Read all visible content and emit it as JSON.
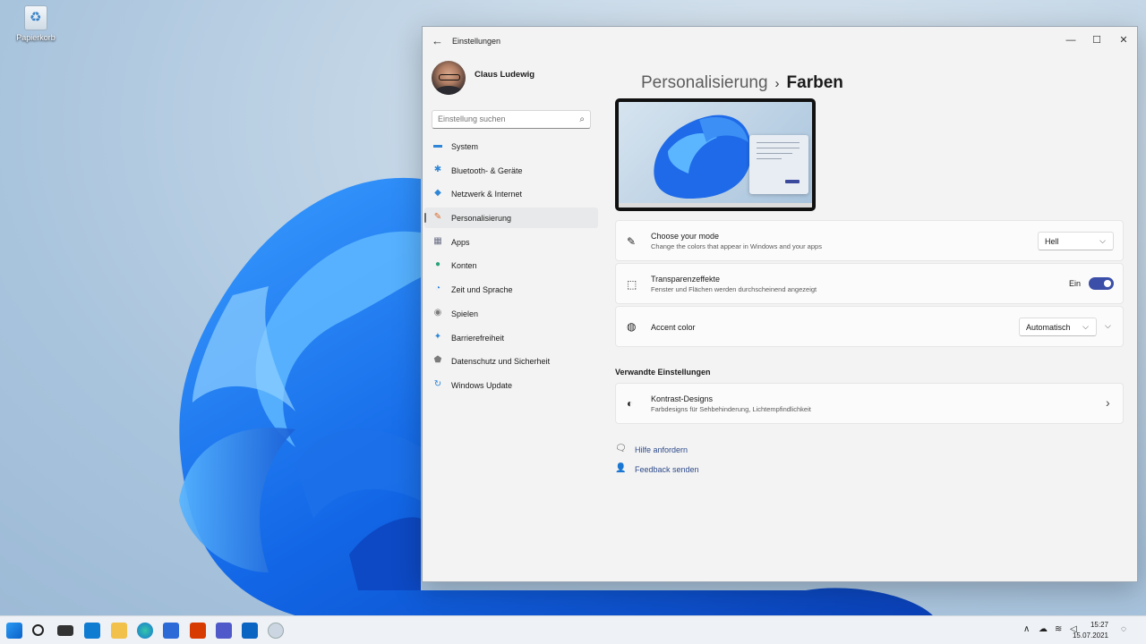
{
  "desktop": {
    "recycle_bin_label": "Papierkorb"
  },
  "window": {
    "title": "Einstellungen",
    "back_icon": "←",
    "minimize": "—",
    "maximize": "☐",
    "close": "✕"
  },
  "profile": {
    "name": "Claus Ludewig"
  },
  "search": {
    "placeholder": "Einstellung suchen",
    "icon": "⌕"
  },
  "nav": [
    {
      "label": "System",
      "icon": "▬",
      "color": "#2f86d8"
    },
    {
      "label": "Bluetooth- & Geräte",
      "icon": "✱",
      "color": "#2f86d8"
    },
    {
      "label": "Netzwerk & Internet",
      "icon": "◆",
      "color": "#2f86d8"
    },
    {
      "label": "Personalisierung",
      "icon": "✎",
      "color": "#d96a2b",
      "active": true
    },
    {
      "label": "Apps",
      "icon": "▦",
      "color": "#6a6f85"
    },
    {
      "label": "Konten",
      "icon": "●",
      "color": "#2aa37a"
    },
    {
      "label": "Zeit und Sprache",
      "icon": "◔",
      "color": "#2f86d8"
    },
    {
      "label": "Spielen",
      "icon": "◉",
      "color": "#7b7b7b"
    },
    {
      "label": "Barrierefreiheit",
      "icon": "✦",
      "color": "#2f86d8"
    },
    {
      "label": "Datenschutz und Sicherheit",
      "icon": "⬟",
      "color": "#7b7b7b"
    },
    {
      "label": "Windows Update",
      "icon": "↻",
      "color": "#2f86d8"
    }
  ],
  "breadcrumb": {
    "parent": "Personalisierung",
    "separator": "›",
    "current": "Farben"
  },
  "settings": {
    "mode": {
      "title": "Choose your mode",
      "subtitle": "Change the colors that appear in Windows and your apps",
      "value": "Hell",
      "icon": "✎"
    },
    "transparency": {
      "title": "Transparenzeffekte",
      "subtitle": "Fenster und Flächen werden durchscheinend angezeigt",
      "state_label": "Ein",
      "on": true,
      "icon": "⬚"
    },
    "accent": {
      "title": "Accent color",
      "value": "Automatisch",
      "icon": "◍"
    }
  },
  "related": {
    "heading": "Verwandte Einstellungen",
    "contrast": {
      "title": "Kontrast-Designs",
      "subtitle": "Farbdesigns für Sehbehinderung, Lichtempfindlichkeit",
      "icon": "◐"
    }
  },
  "links": {
    "help": "Hilfe anfordern",
    "feedback": "Feedback senden"
  },
  "chevrons": {
    "down": "⌵",
    "right": "›"
  },
  "taskbar": {
    "time": "15:27",
    "date": "15.07.2021",
    "accent": "#0078d4"
  }
}
